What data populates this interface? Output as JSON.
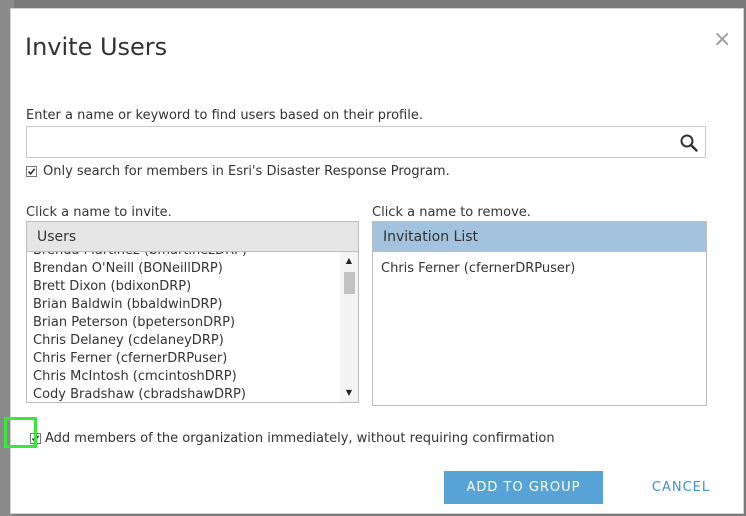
{
  "dialog": {
    "title": "Invite Users",
    "close_icon": "close-icon"
  },
  "search": {
    "prompt": "Enter a name or keyword to find users based on their profile.",
    "value": "",
    "icon": "search-icon",
    "only_members_label": "Only search for members in Esri's Disaster Response Program.",
    "only_members_checked": true
  },
  "users": {
    "instruction": "Click a name to invite.",
    "header": "Users",
    "items": [
      "Brenda Martinez (bmartinezDRP)",
      "Brendan O'Neill (BONeillDRP)",
      "Brett Dixon (bdixonDRP)",
      "Brian Baldwin (bbaldwinDRP)",
      "Brian Peterson (bpetersonDRP)",
      "Chris Delaney (cdelaneyDRP)",
      "Chris Ferner (cfernerDRPuser)",
      "Chris McIntosh (cmcintoshDRP)",
      "Cody Bradshaw (cbradshawDRP)"
    ]
  },
  "invitation": {
    "instruction": "Click a name to remove.",
    "header": "Invitation List",
    "items": [
      "Chris Ferner (cfernerDRPuser)"
    ]
  },
  "add_immediately": {
    "label": "Add members of the organization immediately, without requiring confirmation",
    "checked": true
  },
  "buttons": {
    "add": "ADD TO GROUP",
    "cancel": "CANCEL"
  },
  "colors": {
    "primary": "#57a3d8",
    "link": "#3f8fca",
    "highlight": "#38e83a",
    "invite_header": "#a2c2dd"
  }
}
